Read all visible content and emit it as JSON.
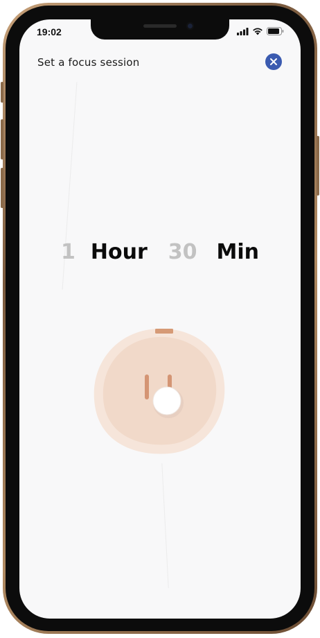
{
  "status_bar": {
    "time": "19:02"
  },
  "header": {
    "title": "Set a focus session",
    "close_icon": "close-icon",
    "close_color": "#3b5bb0"
  },
  "duration": {
    "hours": "1",
    "hours_unit": "Hour",
    "minutes": "30",
    "minutes_unit": "Min"
  },
  "dial": {
    "icon": "power-icon",
    "fill_color": "#f3ddd0",
    "accent_color": "#d99a78",
    "knob_color": "#ffffff"
  }
}
